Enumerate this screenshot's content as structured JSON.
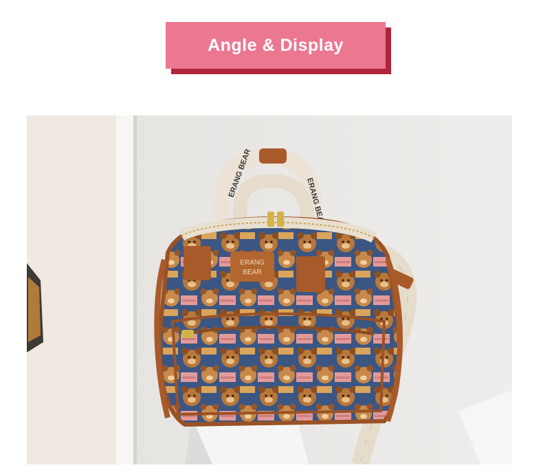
{
  "banner": {
    "title": "Angle & Display",
    "bg_color": "#ec7791",
    "shadow_color": "#b0253a"
  },
  "photo": {
    "handle_text": "ERANG BEAR",
    "patch_text_line1": "ERANG",
    "patch_text_line2": "BEAR",
    "colors": {
      "wall": "#e9e8e6",
      "leather": "#a85a2a",
      "strap": "#ece3d6",
      "print_bg": "#2f4a7a"
    }
  }
}
